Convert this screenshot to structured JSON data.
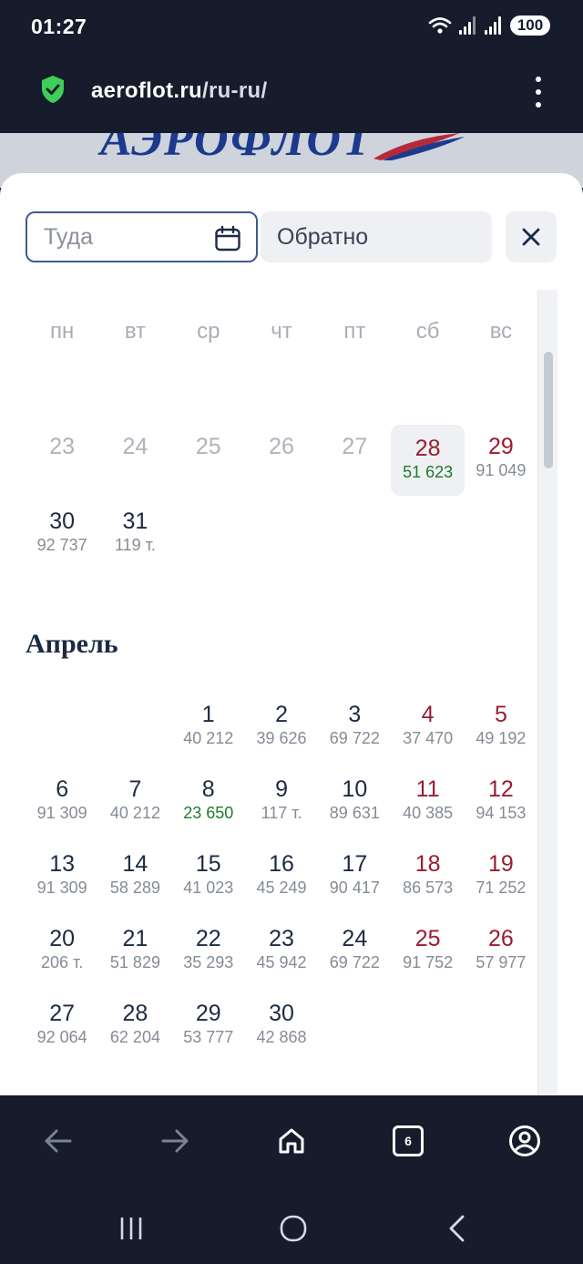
{
  "status": {
    "time": "01:27",
    "battery": "100"
  },
  "browser": {
    "url_host": "aeroflot.ru",
    "url_path": "/ru-ru/",
    "tabs_count": "6"
  },
  "logo": {
    "text": "АЭРОФЛОТ"
  },
  "search": {
    "from_placeholder": "Туда",
    "back_label": "Обратно"
  },
  "weekdays": [
    "пн",
    "вт",
    "ср",
    "чт",
    "пт",
    "сб",
    "вс"
  ],
  "march_rows": [
    {
      "day": "23",
      "price": "",
      "past": true
    },
    {
      "day": "24",
      "price": "",
      "past": true
    },
    {
      "day": "25",
      "price": "",
      "past": true
    },
    {
      "day": "26",
      "price": "",
      "past": true
    },
    {
      "day": "27",
      "price": "",
      "past": true
    },
    {
      "day": "28",
      "price": "51 623",
      "weekend": true,
      "cheap": true,
      "selected": true
    },
    {
      "day": "29",
      "price": "91 049",
      "weekend": true
    },
    {
      "day": "30",
      "price": "92 737"
    },
    {
      "day": "31",
      "price": "119 т."
    }
  ],
  "april": {
    "title": "Апрель",
    "offset": 2,
    "days": [
      {
        "day": "1",
        "price": "40 212"
      },
      {
        "day": "2",
        "price": "39 626"
      },
      {
        "day": "3",
        "price": "69 722"
      },
      {
        "day": "4",
        "price": "37 470",
        "weekend": true
      },
      {
        "day": "5",
        "price": "49 192",
        "weekend": true
      },
      {
        "day": "6",
        "price": "91 309"
      },
      {
        "day": "7",
        "price": "40 212"
      },
      {
        "day": "8",
        "price": "23 650",
        "cheap": true
      },
      {
        "day": "9",
        "price": "117 т."
      },
      {
        "day": "10",
        "price": "89 631"
      },
      {
        "day": "11",
        "price": "40 385",
        "weekend": true
      },
      {
        "day": "12",
        "price": "94 153",
        "weekend": true
      },
      {
        "day": "13",
        "price": "91 309"
      },
      {
        "day": "14",
        "price": "58 289"
      },
      {
        "day": "15",
        "price": "41 023"
      },
      {
        "day": "16",
        "price": "45 249"
      },
      {
        "day": "17",
        "price": "90 417"
      },
      {
        "day": "18",
        "price": "86 573",
        "weekend": true
      },
      {
        "day": "19",
        "price": "71 252",
        "weekend": true
      },
      {
        "day": "20",
        "price": "206 т."
      },
      {
        "day": "21",
        "price": "51 829"
      },
      {
        "day": "22",
        "price": "35 293"
      },
      {
        "day": "23",
        "price": "45 942"
      },
      {
        "day": "24",
        "price": "69 722"
      },
      {
        "day": "25",
        "price": "91 752",
        "weekend": true
      },
      {
        "day": "26",
        "price": "57 977",
        "weekend": true
      },
      {
        "day": "27",
        "price": "92 064"
      },
      {
        "day": "28",
        "price": "62 204"
      },
      {
        "day": "29",
        "price": "53 777"
      },
      {
        "day": "30",
        "price": "42 868"
      }
    ]
  },
  "colors": {
    "weekend": "#9b1c31",
    "cheap": "#1f7a2c",
    "accent": "#3d5a98",
    "chrome": "#161c2b"
  }
}
